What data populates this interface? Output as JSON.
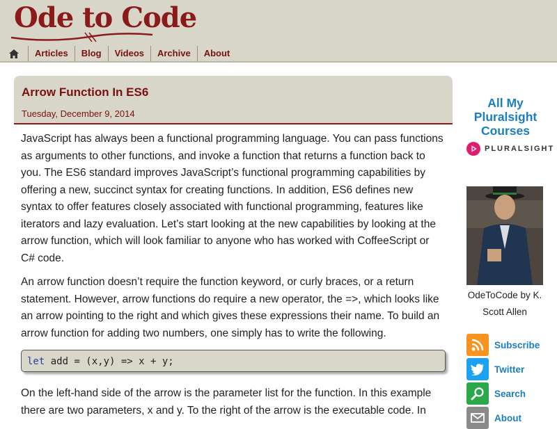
{
  "site": {
    "logo": "Ode to Code"
  },
  "nav": {
    "home_icon": "home-icon",
    "items": [
      "Articles",
      "Blog",
      "Videos",
      "Archive",
      "About"
    ]
  },
  "post": {
    "title": "Arrow Function In ES6",
    "date": "Tuesday, December 9, 2014",
    "p1": "JavaScript has always been a functional programming language. You can pass functions as arguments to other functions, and invoke a function that returns a function back to you. The ES6 standard improves JavaScript’s functional programming capabilities by offering a new, succinct syntax for creating functions. In addition, ES6 defines new syntax to offer features closely associated with functional programming, features like iterators and lazy evaluation. Let’s start looking at the new capabilities by looking at the arrow function, which will look familiar to anyone who has worked with CoffeeScript or C# code.",
    "p2": "An arrow function doesn’t require the function keyword, or curly braces, or a return statement. However, arrow functions do require a new operator, the =>, which looks like an arrow pointing to the right and which gives these expressions their name. To build an arrow function for adding two numbers, one simply has to write the following.",
    "code_keyword": "let",
    "code_rest": " add = (x,y) => x + y;",
    "p3": "On the left-hand side of the arrow is the parameter list for the function. In this example there are two parameters, x and y. To the right of the arrow is the executable code. In"
  },
  "sidebar": {
    "courses_title": "All My Pluralsight Courses",
    "pluralsight_label": "PLURALSIGHT",
    "author_caption": "OdeToCode by K. Scott Allen",
    "links": [
      {
        "label": "Subscribe",
        "icon": "rss-icon",
        "color": "#f7931e"
      },
      {
        "label": "Twitter",
        "icon": "twitter-icon",
        "color": "#1da1f2"
      },
      {
        "label": "Search",
        "icon": "search-icon",
        "color": "#2aa84a"
      },
      {
        "label": "About",
        "icon": "mail-icon",
        "color": "#8a8a8a"
      }
    ]
  },
  "colors": {
    "accent": "#8b1a1a",
    "header_bg": "#d8d6c8",
    "link_blue": "#1b7fbf"
  }
}
